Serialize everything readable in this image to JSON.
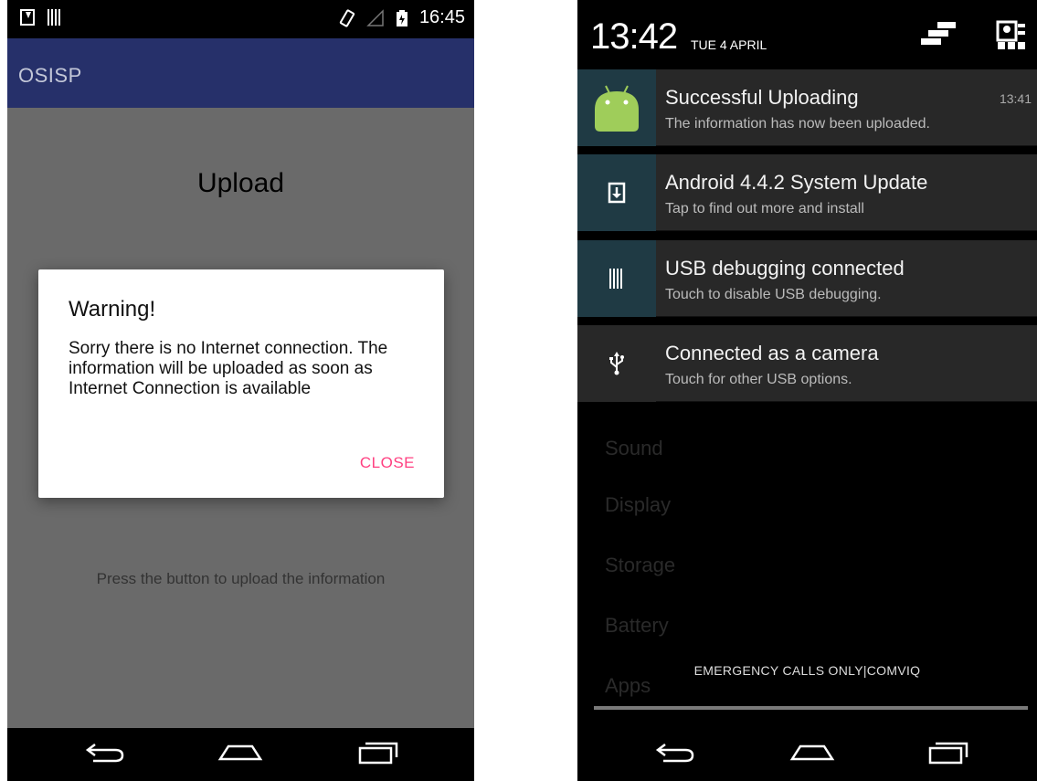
{
  "left": {
    "status": {
      "time": "16:45"
    },
    "app_title": "OSISP",
    "page_title": "Upload",
    "hint": "Press the button to upload the information",
    "dialog": {
      "title": "Warning!",
      "message": "Sorry there is no Internet connection. The information will be uploaded as soon as Internet Connection is available",
      "close_label": "CLOSE"
    },
    "icons": [
      "download-icon",
      "usb-debug-icon",
      "vibrate-icon",
      "signal-icon",
      "battery-icon",
      "back-icon",
      "home-icon",
      "recents-icon"
    ]
  },
  "right": {
    "clock": "13:42",
    "date": "TUE 4 APRIL",
    "notifications": [
      {
        "title": "Successful Uploading",
        "subtitle": "The information has now been uploaded.",
        "time": "13:41",
        "icon": "android-icon"
      },
      {
        "title": "Android 4.4.2 System Update",
        "subtitle": "Tap to find out more and install",
        "icon": "download-icon"
      },
      {
        "title": "USB debugging connected",
        "subtitle": "Touch to disable USB debugging.",
        "icon": "usb-debug-icon"
      },
      {
        "title": "Connected as a camera",
        "subtitle": "Touch for other USB options.",
        "icon": "usb-icon"
      }
    ],
    "background_settings": [
      "Sound",
      "Display",
      "Storage",
      "Battery",
      "Apps"
    ],
    "carrier": "EMERGENCY CALLS ONLY|COMVIQ",
    "colors": {
      "accent": "#ff4081",
      "appbar": "#26306a",
      "notif_icon_bg": "#1f3a44"
    }
  }
}
